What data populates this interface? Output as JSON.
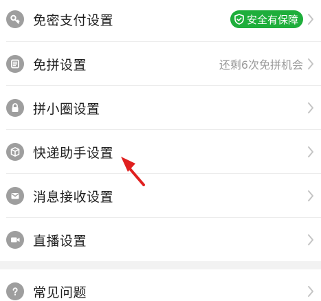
{
  "settings": {
    "items": [
      {
        "label": "免密支付设置",
        "icon": "key-icon",
        "badge": "安全有保障"
      },
      {
        "label": "免拼设置",
        "icon": "ticket-icon",
        "hint": "还剩6次免拼机会"
      },
      {
        "label": "拼小圈设置",
        "icon": "lock-icon"
      },
      {
        "label": "快递助手设置",
        "icon": "package-icon"
      },
      {
        "label": "消息接收设置",
        "icon": "mail-icon"
      },
      {
        "label": "直播设置",
        "icon": "video-camera-icon"
      }
    ],
    "help": {
      "label": "常见问题",
      "icon": "question-icon"
    }
  },
  "colors": {
    "badge_green": "#1eae3b",
    "icon_gray": "#9e9e9e",
    "annotation_red": "#e0201f"
  }
}
